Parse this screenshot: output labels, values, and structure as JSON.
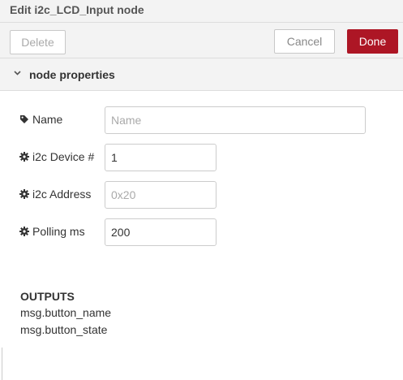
{
  "dialog": {
    "title": "Edit i2c_LCD_Input node"
  },
  "toolbar": {
    "delete_label": "Delete",
    "cancel_label": "Cancel",
    "done_label": "Done"
  },
  "section": {
    "title": "node properties",
    "icon": "chevron-down-icon"
  },
  "fields": {
    "name": {
      "label": "Name",
      "icon": "tag-icon",
      "value": "",
      "placeholder": "Name"
    },
    "device": {
      "label": "i2c Device #",
      "icon": "gear-icon",
      "value": "1",
      "placeholder": ""
    },
    "address": {
      "label": "i2c Address",
      "icon": "gear-icon",
      "value": "",
      "placeholder": "0x20"
    },
    "polling": {
      "label": "Polling ms",
      "icon": "gear-icon",
      "value": "200",
      "placeholder": ""
    }
  },
  "outputs": {
    "title": "OUTPUTS",
    "lines": [
      "msg.button_name",
      "msg.button_state"
    ]
  },
  "colors": {
    "primary": "#ad1625",
    "header_bg": "#f3f3f3",
    "border": "#dddddd"
  }
}
